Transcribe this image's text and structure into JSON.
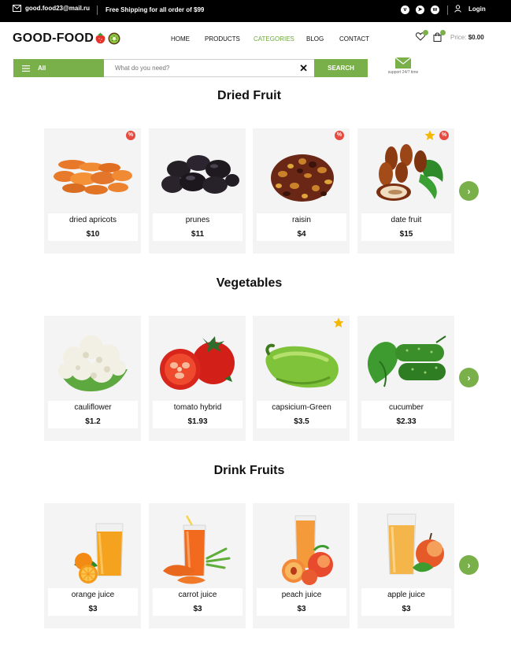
{
  "topbar": {
    "email": "good.food23@mail.ru",
    "shipping": "Free Shipping for all order of $99",
    "login": "Login"
  },
  "header": {
    "logo": "GOOD-FOOD",
    "nav": [
      "HOME",
      "PRODUCTS",
      "CATEGORIES",
      "BLOG",
      "CONTACT"
    ],
    "active_nav": "CATEGORIES",
    "price_label": "Price:",
    "price_value": "$0.00"
  },
  "search": {
    "category": "All",
    "placeholder": "What do you need?",
    "button": "SEARCH",
    "support": "support 24/7 time"
  },
  "colors": {
    "accent": "#7ab04a",
    "sale": "#e94a3f",
    "star": "#f5b700"
  },
  "sections": [
    {
      "title": "Dried Fruit",
      "products": [
        {
          "name": "dried apricots",
          "price": "$10",
          "sale": true,
          "star": false
        },
        {
          "name": "prunes",
          "price": "$11",
          "sale": false,
          "star": false
        },
        {
          "name": "raisin",
          "price": "$4",
          "sale": true,
          "star": false
        },
        {
          "name": "date fruit",
          "price": "$15",
          "sale": true,
          "star": true
        }
      ]
    },
    {
      "title": "Vegetables",
      "products": [
        {
          "name": "cauliflower",
          "price": "$1.2",
          "sale": false,
          "star": false
        },
        {
          "name": "tomato hybrid",
          "price": "$1.93",
          "sale": false,
          "star": false
        },
        {
          "name": "capsicium-Green",
          "price": "$3.5",
          "sale": false,
          "star": true
        },
        {
          "name": "cucumber",
          "price": "$2.33",
          "sale": false,
          "star": false
        }
      ]
    },
    {
      "title": "Drink Fruits",
      "products": [
        {
          "name": "orange juice",
          "price": "$3",
          "sale": false,
          "star": false
        },
        {
          "name": "carrot juice",
          "price": "$3",
          "sale": false,
          "star": false
        },
        {
          "name": "peach juice",
          "price": "$3",
          "sale": false,
          "star": false
        },
        {
          "name": "apple juice",
          "price": "$3",
          "sale": false,
          "star": false
        }
      ]
    }
  ]
}
